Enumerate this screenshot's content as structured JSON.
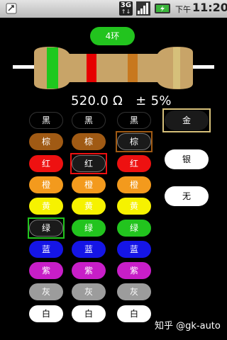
{
  "status_bar": {
    "network": "3G",
    "network_sub": "↑↓",
    "time_prefix": "下午",
    "time": "11:20"
  },
  "band_count_label": "4环",
  "value_display": "520.0 Ω   ± 5%",
  "resistor": {
    "body_color": "#c8a468",
    "band_colors": [
      "#1ec81e",
      "#e60000",
      "#c8781e",
      "#d6c07a"
    ]
  },
  "color_names": [
    "黑",
    "棕",
    "红",
    "橙",
    "黄",
    "绿",
    "蓝",
    "紫",
    "灰",
    "白"
  ],
  "color_hex": [
    "#000000",
    "#a05a14",
    "#ee1111",
    "#f39a1d",
    "#f6f200",
    "#22c41e",
    "#1515e6",
    "#c81ec8",
    "#9c9c9c",
    "#ffffff"
  ],
  "text_colors": [
    "#ffffff",
    "#ffffff",
    "#ffffff",
    "#ffffff",
    "#ffffff",
    "#ffffff",
    "#ffffff",
    "#ffffff",
    "#ffffff",
    "#000000"
  ],
  "selected": {
    "band1": "绿",
    "band2": "红",
    "band3": "棕"
  },
  "tolerance": [
    {
      "label": "金",
      "bg": "#1a1a1a",
      "fg": "#ffffff",
      "frame": "#d6c07a"
    },
    {
      "label": "银",
      "bg": "#ffffff",
      "fg": "#000000"
    },
    {
      "label": "无",
      "bg": "#ffffff",
      "fg": "#000000"
    }
  ],
  "footer": "知乎 @gk-auto"
}
